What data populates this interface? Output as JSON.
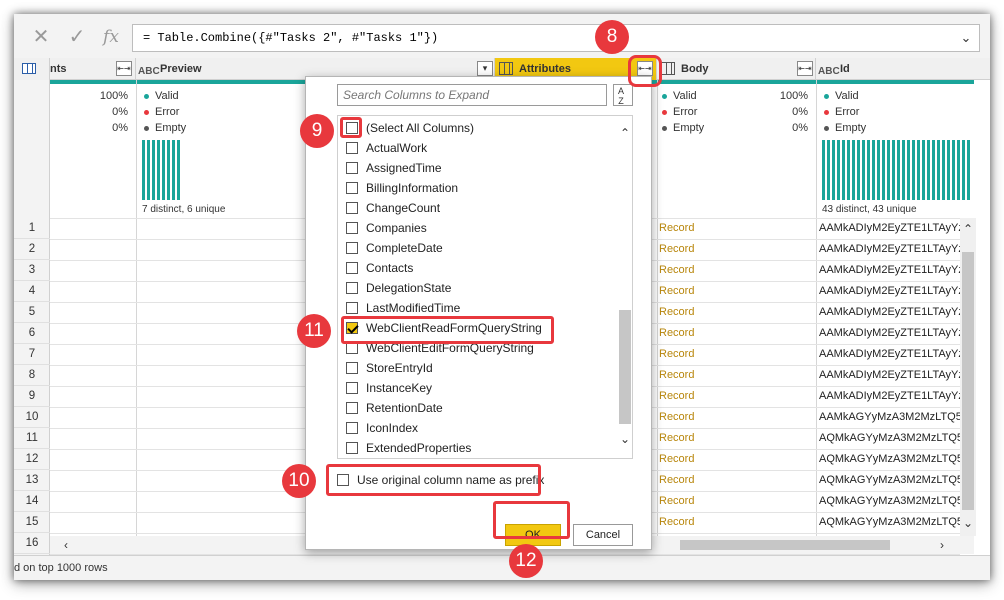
{
  "formula_bar": {
    "cancel_icon": "close-icon",
    "confirm_icon": "checkmark-icon",
    "fx_label": "fx",
    "formula": "= Table.Combine({#\"Tasks 2\", #\"Tasks 1\"})"
  },
  "columns": [
    {
      "name": "nts",
      "type": "table"
    },
    {
      "name": "Preview",
      "type": "ABC"
    },
    {
      "name": "Attributes",
      "type": "table"
    },
    {
      "name": "Body",
      "type": "table"
    },
    {
      "name": "Id",
      "type": "ABC"
    }
  ],
  "profile": {
    "first_col": {
      "valid": "100%",
      "error": "0%",
      "empty": "0%"
    },
    "preview": {
      "valid": "Valid",
      "error": "Error",
      "empty": "Empty",
      "distinct": "7 distinct, 6 unique"
    },
    "body": {
      "valid": "Valid",
      "error": "Error",
      "empty": "Empty",
      "valid_pct": "100%",
      "error_pct": "0%",
      "empty_pct": "0%"
    },
    "id": {
      "valid": "Valid",
      "error": "Error",
      "empty": "Empty",
      "distinct": "43 distinct, 43 unique"
    }
  },
  "row_numbers": [
    "1",
    "2",
    "3",
    "4",
    "5",
    "6",
    "7",
    "8",
    "9",
    "10",
    "11",
    "12",
    "13",
    "14",
    "15",
    "16"
  ],
  "body_values": [
    "Record",
    "Record",
    "Record",
    "Record",
    "Record",
    "Record",
    "Record",
    "Record",
    "Record",
    "Record",
    "Record",
    "Record",
    "Record",
    "Record",
    "Record"
  ],
  "id_values": [
    "AAMkADIyM2EyZTE1LTAyYzM",
    "AAMkADIyM2EyZTE1LTAyYzM",
    "AAMkADIyM2EyZTE1LTAyYzM",
    "AAMkADIyM2EyZTE1LTAyYzM",
    "AAMkADIyM2EyZTE1LTAyYzM",
    "AAMkADIyM2EyZTE1LTAyYzM",
    "AAMkADIyM2EyZTE1LTAyYzM",
    "AAMkADIyM2EyZTE1LTAyYzM",
    "AAMkADIyM2EyZTE1LTAyYzM",
    "AAMkAGYyMzA3M2MzLTQ5N",
    "AQMkAGYyMzA3M2MzLTQ5N",
    "AQMkAGYyMzA3M2MzLTQ5N",
    "AQMkAGYyMzA3M2MzLTQ5N",
    "AQMkAGYyMzA3M2MzLTQ5N",
    "AQMkAGYyMzA3M2MzLTQ5N"
  ],
  "expand_popup": {
    "search_placeholder": "Search Columns to Expand",
    "sort_label": "A Z",
    "items": [
      {
        "label": "(Select All Columns)",
        "checked": false
      },
      {
        "label": "ActualWork",
        "checked": false
      },
      {
        "label": "AssignedTime",
        "checked": false
      },
      {
        "label": "BillingInformation",
        "checked": false
      },
      {
        "label": "ChangeCount",
        "checked": false
      },
      {
        "label": "Companies",
        "checked": false
      },
      {
        "label": "CompleteDate",
        "checked": false
      },
      {
        "label": "Contacts",
        "checked": false
      },
      {
        "label": "DelegationState",
        "checked": false
      },
      {
        "label": "LastModifiedTime",
        "checked": false
      },
      {
        "label": "WebClientReadFormQueryString",
        "checked": true
      },
      {
        "label": "WebClientEditFormQueryString",
        "checked": false
      },
      {
        "label": "StoreEntryId",
        "checked": false
      },
      {
        "label": "InstanceKey",
        "checked": false
      },
      {
        "label": "RetentionDate",
        "checked": false
      },
      {
        "label": "IconIndex",
        "checked": false
      },
      {
        "label": "ExtendedProperties",
        "checked": false
      }
    ],
    "prefix_label": "Use original column name as prefix",
    "ok_label": "OK",
    "cancel_label": "Cancel"
  },
  "status_text": "d on top 1000 rows",
  "callouts": [
    "8",
    "9",
    "10",
    "11",
    "12"
  ],
  "colors": {
    "accent": "#f2c811",
    "teal": "#1aa59a",
    "callout": "#e8383d",
    "record": "#b8860b"
  }
}
